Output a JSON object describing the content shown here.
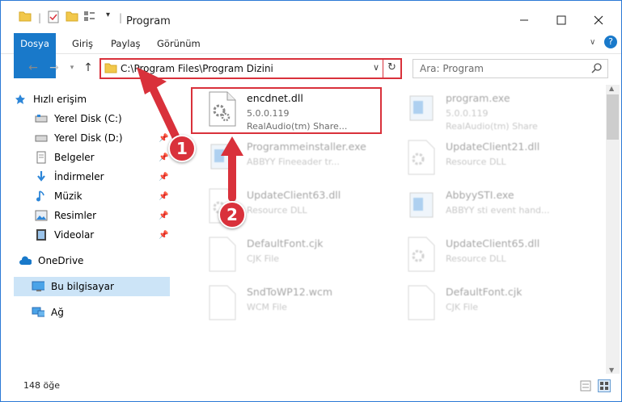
{
  "window": {
    "title": "Program"
  },
  "ribbon": {
    "tabs": [
      "Dosya",
      "Giriş",
      "Paylaş",
      "Görünüm"
    ]
  },
  "address": {
    "path": "C:\\Program Files\\Program Dizini"
  },
  "search": {
    "placeholder": "Ara: Program"
  },
  "nav": {
    "items": [
      {
        "label": "Hızlı erişim",
        "icon": "star-icon",
        "pinned": false
      },
      {
        "label": "Yerel Disk (C:)",
        "icon": "drive-icon",
        "pinned": false
      },
      {
        "label": "Yerel Disk (D:)",
        "icon": "drive-icon",
        "pinned": true
      },
      {
        "label": "Belgeler",
        "icon": "documents-icon",
        "pinned": true
      },
      {
        "label": "İndirmeler",
        "icon": "download-icon",
        "pinned": true
      },
      {
        "label": "Müzik",
        "icon": "music-icon",
        "pinned": true
      },
      {
        "label": "Resimler",
        "icon": "pictures-icon",
        "pinned": true
      },
      {
        "label": "Videolar",
        "icon": "videos-icon",
        "pinned": true
      },
      {
        "label": "OneDrive",
        "icon": "cloud-icon",
        "pinned": false
      },
      {
        "label": "Bu bilgisayar",
        "icon": "computer-icon",
        "pinned": false
      },
      {
        "label": "Ağ",
        "icon": "network-icon",
        "pinned": false
      }
    ]
  },
  "files": [
    {
      "name": "encdnet.dll",
      "version": "5.0.0.119",
      "desc": "RealAudio(tm) Share...",
      "highlighted": true
    },
    {
      "name": "program.exe",
      "version": "5.0.0.119",
      "desc": "RealAudio(tm) Share",
      "highlighted": false
    },
    {
      "name": "Programmeinstaller.exe",
      "version": "",
      "desc": "ABBYY Fineeader tr...",
      "highlighted": false
    },
    {
      "name": "UpdateClient21.dll",
      "version": "",
      "desc": "Resource DLL",
      "highlighted": false
    },
    {
      "name": "UpdateClient63.dll",
      "version": "",
      "desc": "Resource DLL",
      "highlighted": false
    },
    {
      "name": "AbbyySTI.exe",
      "version": "",
      "desc": "ABBYY sti event hand...",
      "highlighted": false
    },
    {
      "name": "DefaultFont.cjk",
      "version": "",
      "desc": "CJK File",
      "highlighted": false
    },
    {
      "name": "UpdateClient65.dll",
      "version": "",
      "desc": "Resource DLL",
      "highlighted": false
    },
    {
      "name": "SndToWP12.wcm",
      "version": "",
      "desc": "WCM File",
      "highlighted": false
    },
    {
      "name": "DefaultFont.cjk",
      "version": "",
      "desc": "CJK File",
      "highlighted": false
    }
  ],
  "annotations": {
    "step1": "1",
    "step2": "2"
  },
  "status": {
    "count": "148 öğe"
  },
  "colors": {
    "accent": "#1979ca",
    "highlight": "#d9313b",
    "selection": "#cce4f7"
  }
}
